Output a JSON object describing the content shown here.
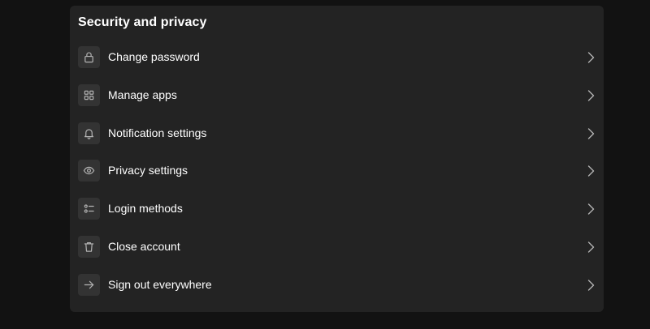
{
  "section": {
    "title": "Security and privacy"
  },
  "items": [
    {
      "label": "Change password",
      "icon": "lock-icon"
    },
    {
      "label": "Manage apps",
      "icon": "grid-icon"
    },
    {
      "label": "Notification settings",
      "icon": "bell-icon"
    },
    {
      "label": "Privacy settings",
      "icon": "eye-icon"
    },
    {
      "label": "Login methods",
      "icon": "list-icon"
    },
    {
      "label": "Close account",
      "icon": "trash-icon"
    },
    {
      "label": "Sign out everywhere",
      "icon": "arrow-right-icon"
    }
  ],
  "colors": {
    "background": "#121212",
    "card": "#232323",
    "icon_box": "#333333",
    "text": "#ffffff",
    "icon": "#b3b3b3"
  }
}
